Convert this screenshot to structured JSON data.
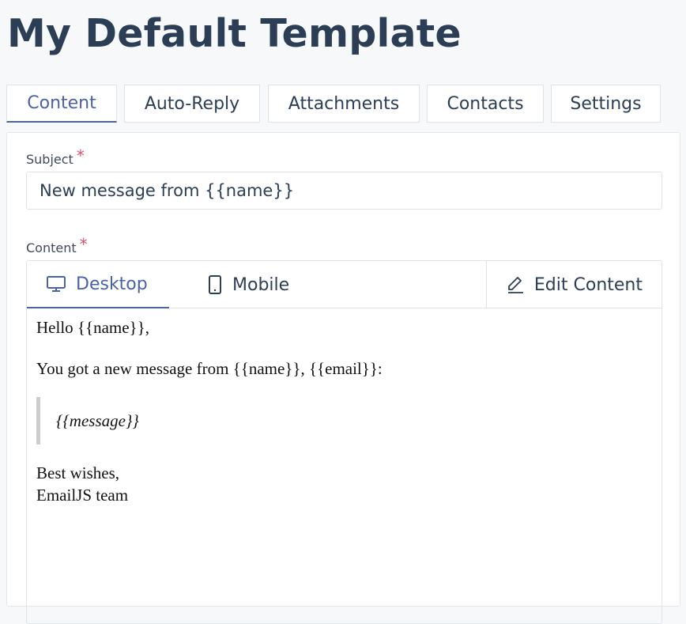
{
  "page": {
    "title": "My Default Template"
  },
  "tabs": [
    {
      "label": "Content",
      "active": true
    },
    {
      "label": "Auto-Reply",
      "active": false
    },
    {
      "label": "Attachments",
      "active": false
    },
    {
      "label": "Contacts",
      "active": false
    },
    {
      "label": "Settings",
      "active": false
    }
  ],
  "form": {
    "subject_label": "Subject",
    "subject_value": "New message from {{name}}",
    "content_label": "Content",
    "required_mark": "*"
  },
  "editor": {
    "view_tabs": [
      {
        "label": "Desktop",
        "icon": "monitor-icon",
        "active": true
      },
      {
        "label": "Mobile",
        "icon": "mobile-phone-icon",
        "active": false
      }
    ],
    "edit_label": "Edit Content",
    "edit_icon": "pencil-icon"
  },
  "preview": {
    "greeting": "Hello {{name}},",
    "intro": "You got a new message from {{name}}, {{email}}:",
    "quote": "{{message}}",
    "signoff_1": "Best wishes,",
    "signoff_2": "EmailJS team"
  },
  "colors": {
    "accent": "#4a62a8",
    "title": "#2c3e55",
    "required": "#d9536e",
    "border": "#dfe3e8",
    "background": "#f7f8fa"
  }
}
